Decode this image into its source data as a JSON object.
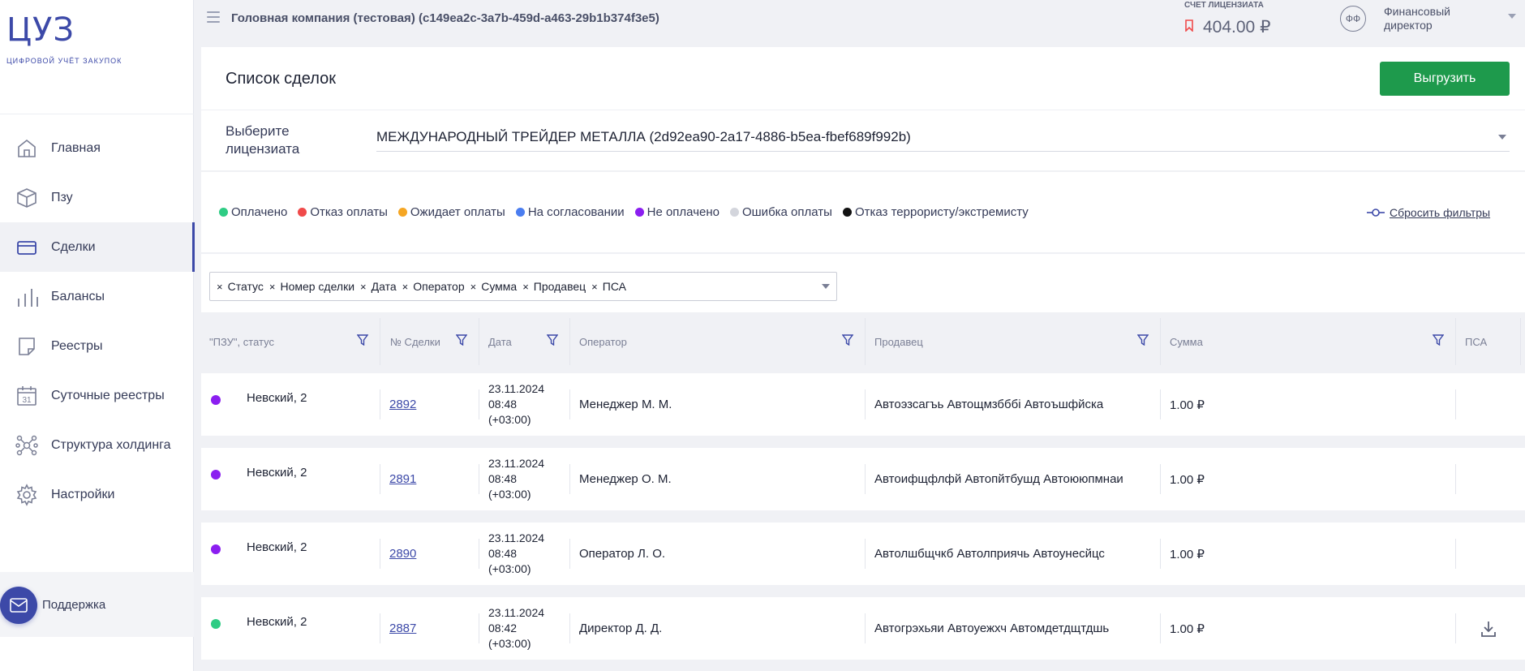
{
  "sidebar": {
    "logo": "ЦУЗ",
    "logo_sub": "цифровой учёт закупок",
    "items": [
      {
        "label": "Главная",
        "icon": "home-icon"
      },
      {
        "label": "Пзу",
        "icon": "box-icon"
      },
      {
        "label": "Сделки",
        "icon": "card-icon",
        "active": true
      },
      {
        "label": "Балансы",
        "icon": "bars-icon"
      },
      {
        "label": "Реестры",
        "icon": "note-icon"
      },
      {
        "label": "Суточные реестры",
        "icon": "calendar-icon"
      },
      {
        "label": "Структура холдинга",
        "icon": "structure-icon"
      },
      {
        "label": "Настройки",
        "icon": "gear-icon"
      }
    ],
    "calendar_day": "31",
    "support_label": "Поддержка"
  },
  "topbar": {
    "company": "Головная компания (тестовая) (c149ea2c-3a7b-459d-a463-29b1b374f3e5)",
    "account_caption": "Счет лицензиата",
    "account_value": "404.00 ₽",
    "avatar_initials": "ФФ",
    "role": "Финансовый директор"
  },
  "page": {
    "title": "Список сделок",
    "export_label": "Выгрузить",
    "licensee_label": "Выберите лицензиата",
    "licensee_value": "МЕЖДУНАРОДНЫЙ ТРЕЙДЕР МЕТАЛЛА (2d92ea90-2a17-4886-b5ea-fbef689f992b)"
  },
  "legend": [
    {
      "label": "Оплачено",
      "color": "#2ecc84"
    },
    {
      "label": "Отказ оплаты",
      "color": "#f04a4a"
    },
    {
      "label": "Ожидает оплаты",
      "color": "#f5a623"
    },
    {
      "label": "На согласовании",
      "color": "#4a7df0"
    },
    {
      "label": "Не оплачено",
      "color": "#8b1ef0"
    },
    {
      "label": "Ошибка оплаты",
      "color": "#d3d5dc"
    },
    {
      "label": "Отказ террористу/экстремисту",
      "color": "#111111"
    }
  ],
  "reset_filters": "Сбросить фильтры",
  "column_chips": [
    "Статус",
    "Номер сделки",
    "Дата",
    "Оператор",
    "Сумма",
    "Продавец",
    "ПСА"
  ],
  "table": {
    "headers": [
      "\"ПЗУ\", статус",
      "№ Сделки",
      "Дата",
      "Оператор",
      "Продавец",
      "Сумма",
      "ПСА"
    ],
    "rows": [
      {
        "status_color": "#8b1ef0",
        "pzu": "Невский, 2",
        "deal": "2892",
        "date1": "23.11.2024",
        "date2": "08:48",
        "date3": "(+03:00)",
        "operator": "Менеджер М. М.",
        "seller": "Автоэзсагъь Автощмзбббі Автоъшфйска",
        "sum": "1.00 ₽",
        "psa": false
      },
      {
        "status_color": "#8b1ef0",
        "pzu": "Невский, 2",
        "deal": "2891",
        "date1": "23.11.2024",
        "date2": "08:48",
        "date3": "(+03:00)",
        "operator": "Менеджер О. М.",
        "seller": "Автоифщфлфй Автопйтбушд Автоююпмнаи",
        "sum": "1.00 ₽",
        "psa": false
      },
      {
        "status_color": "#8b1ef0",
        "pzu": "Невский, 2",
        "deal": "2890",
        "date1": "23.11.2024",
        "date2": "08:48",
        "date3": "(+03:00)",
        "operator": "Оператор Л. О.",
        "seller": "Автолшбщчкб Автолприячь Автоунесйцс",
        "sum": "1.00 ₽",
        "psa": false
      },
      {
        "status_color": "#2ecc84",
        "pzu": "Невский, 2",
        "deal": "2887",
        "date1": "23.11.2024",
        "date2": "08:42",
        "date3": "(+03:00)",
        "operator": "Директор Д. Д.",
        "seller": "Автогрэхьяи Автоуежхч Автомдетдщтдшь",
        "sum": "1.00 ₽",
        "psa": true
      }
    ]
  }
}
